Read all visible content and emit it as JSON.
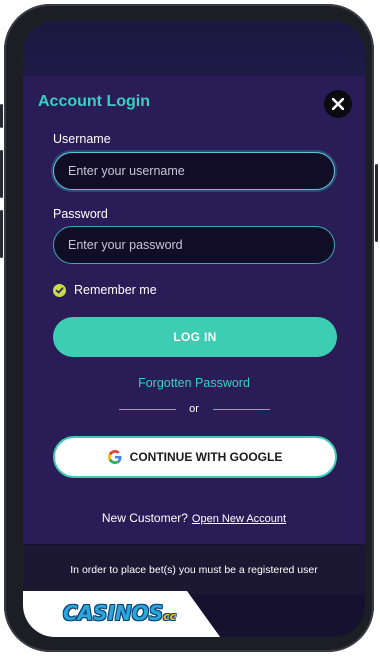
{
  "modal": {
    "title": "Account Login",
    "username_label": "Username",
    "username_placeholder": "Enter your username",
    "password_label": "Password",
    "password_placeholder": "Enter your password",
    "remember_label": "Remember me",
    "login_button": "LOG IN",
    "forgot_link": "Forgotten Password",
    "or_text": "or",
    "google_button": "CONTINUE WITH GOOGLE",
    "new_customer_text": "New Customer?",
    "open_account_link": "Open New Account",
    "footer_notice": "In order to place bet(s) you must be a registered user"
  },
  "brand": {
    "logo_text": "CASINOS",
    "logo_suffix": "cc",
    "accent_color": "#3ccfc0",
    "modal_bg": "#2a1d57"
  },
  "icons": {
    "close": "close-icon",
    "check": "check-icon",
    "google": "google-icon"
  }
}
